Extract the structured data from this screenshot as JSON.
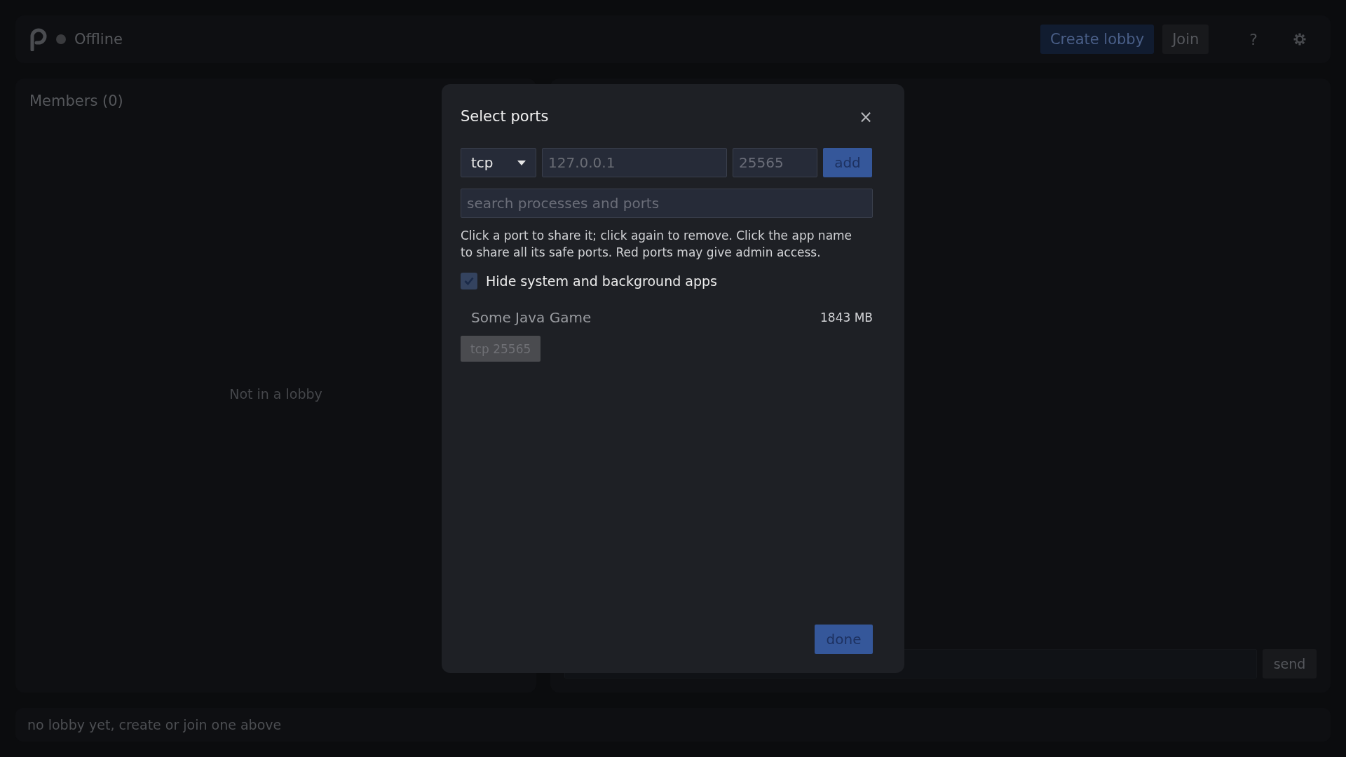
{
  "header": {
    "status": {
      "label": "Offline",
      "online": false
    },
    "buttons": [
      {
        "kind": "primary",
        "label": "Create lobby"
      },
      {
        "kind": "secondary",
        "label": "Join"
      }
    ],
    "help": "?"
  },
  "members": {
    "title": "Members (0)",
    "empty": "Not in a lobby"
  },
  "chat": {
    "send": "send"
  },
  "status_bar": "no lobby yet, create or join one above",
  "dialog": {
    "title": "Select ports",
    "close": "×",
    "protocol": "tcp",
    "address": {
      "placeholder": "127.0.0.1"
    },
    "port": {
      "placeholder": "25565"
    },
    "add": "add",
    "search": {
      "placeholder": "search processes and ports"
    },
    "help": "Click a port to share it; click again to remove. Click the app name to share all its safe ports. Red ports may give admin access.",
    "hide_system": {
      "label": "Hide system and background apps",
      "checked": true
    },
    "apps": [
      {
        "name": "Some Java Game",
        "memory": "1843 MB",
        "ports": [
          {
            "label": "tcp 25565",
            "selected": false
          }
        ]
      }
    ],
    "done": "done"
  }
}
